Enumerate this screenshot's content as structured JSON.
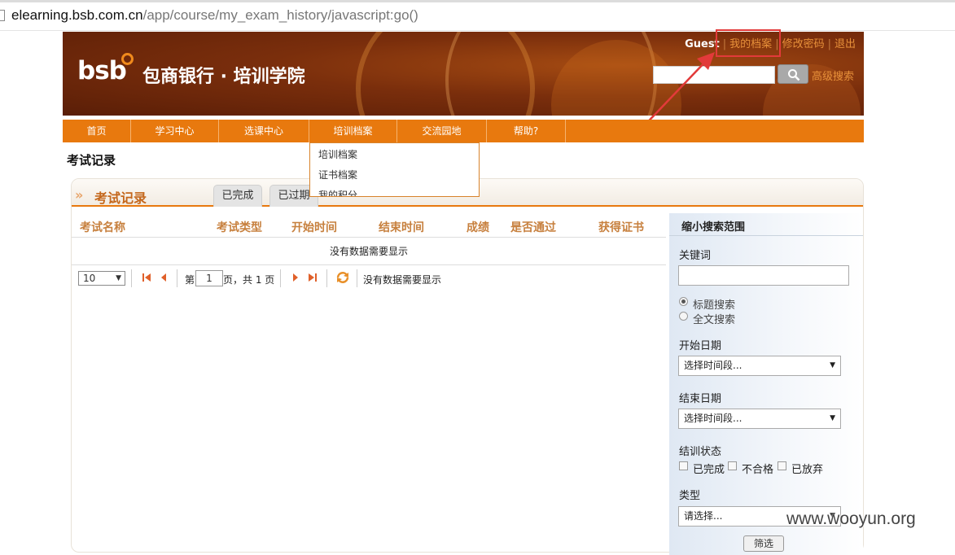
{
  "browser": {
    "url_host": "elearning.bsb.com.cn",
    "url_path": "/app/course/my_exam_history/javascript:go()"
  },
  "header": {
    "logo_text": "bsb",
    "site_name": "包商银行 · 培训学院",
    "user_name": "Guest",
    "links": {
      "my_profile": "我的档案",
      "change_password": "修改密码",
      "logout": "退出"
    },
    "advanced_search": "高级搜索"
  },
  "nav": {
    "items": [
      "首页",
      "学习中心",
      "选课中心",
      "培训档案",
      "交流园地",
      "帮助?"
    ],
    "dropdown": [
      "培训档案",
      "证书档案",
      "我的积分"
    ]
  },
  "page": {
    "title": "考试记录",
    "panel_title": "考试记录",
    "tabs": [
      "已完成",
      "已过期"
    ]
  },
  "table": {
    "headers": [
      "考试名称",
      "考试类型",
      "开始时间",
      "结束时间",
      "成绩",
      "是否通过",
      "获得证书"
    ],
    "empty_message": "没有数据需要显示"
  },
  "pager": {
    "page_size": "10",
    "page_prefix": "第",
    "page_number": "1",
    "page_suffix": "页，共 1 页",
    "status": "没有数据需要显示"
  },
  "sidebar": {
    "title": "缩小搜索范围",
    "keyword_label": "关键词",
    "radio_options": [
      "标题搜索",
      "全文搜索"
    ],
    "start_date_label": "开始日期",
    "start_date_value": "选择时间段...",
    "end_date_label": "结束日期",
    "end_date_value": "选择时间段...",
    "status_label": "结训状态",
    "status_options": [
      "已完成",
      "不合格",
      "已放弃"
    ],
    "type_label": "类型",
    "type_value": "请选择...",
    "filter_button": "筛选"
  },
  "watermark": "www.wooyun.org",
  "colors": {
    "accent": "#e8790e",
    "header_bg": "#6b250a",
    "annotation": "#e23a3a"
  }
}
